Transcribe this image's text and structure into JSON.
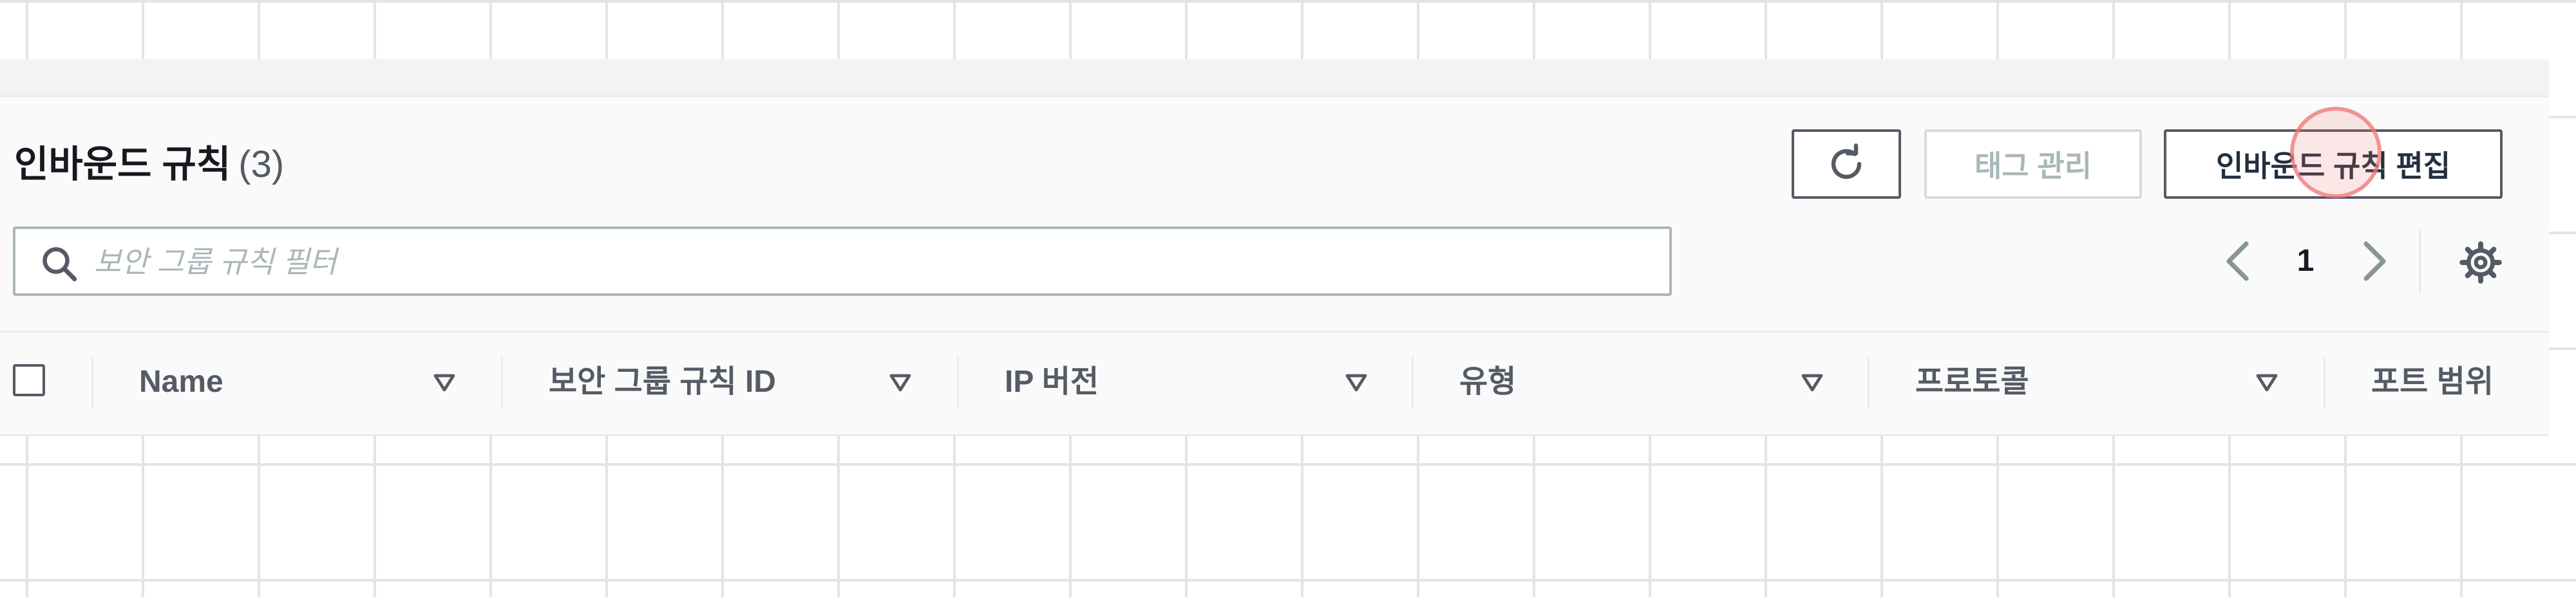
{
  "panel": {
    "title": "인바운드 규칙",
    "count": "(3)"
  },
  "actions": {
    "refresh_icon": "refresh-icon",
    "manage_tags_label": "태그 관리",
    "edit_rules_label": "인바운드 규칙 편집"
  },
  "search": {
    "icon": "search-icon",
    "placeholder": "보안 그룹 규칙 필터",
    "value": ""
  },
  "pagination": {
    "current_page": "1",
    "prev_icon": "chevron-left-icon",
    "next_icon": "chevron-right-icon",
    "settings_icon": "gear-icon"
  },
  "table": {
    "columns": [
      "Name",
      "보안 그룹 규칙 ID",
      "IP 버전",
      "유형",
      "프로토콜",
      "포트 범위"
    ]
  },
  "colors": {
    "text_primary": "#16191f",
    "text_secondary": "#545b64",
    "disabled": "#aab7b8",
    "border": "#545b64",
    "click_indicator": "#ee7878"
  }
}
